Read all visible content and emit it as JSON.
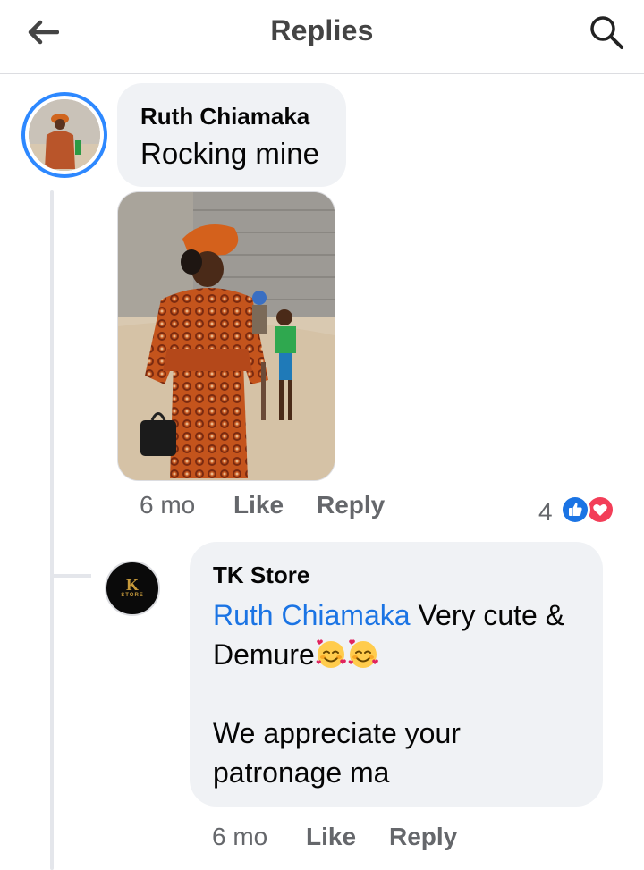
{
  "header": {
    "title": "Replies",
    "back_icon": "arrow-left-icon",
    "search_icon": "search-icon"
  },
  "comment": {
    "author": "Ruth Chiamaka",
    "text": "Rocking mine",
    "time": "6 mo",
    "like_label": "Like",
    "reply_label": "Reply",
    "reaction_count": "4",
    "reactions": [
      "like-icon",
      "love-icon"
    ]
  },
  "reply": {
    "author": "TK Store",
    "avatar_logo_text": "K",
    "avatar_logo_sub": "STORE",
    "mention": "Ruth Chiamaka",
    "text_line1": " Very cute & Demure",
    "emojis": [
      "smiling-face-with-hearts-icon",
      "smiling-face-with-hearts-icon"
    ],
    "text_para2": "We appreciate your patronage ma",
    "time": "6 mo",
    "like_label": "Like",
    "reply_label": "Reply"
  },
  "colors": {
    "accent": "#1b74e4",
    "avatar_ring": "#2d88ff",
    "bubble": "#f0f2f5",
    "meta_text": "#65676b",
    "love": "#f33e58"
  }
}
